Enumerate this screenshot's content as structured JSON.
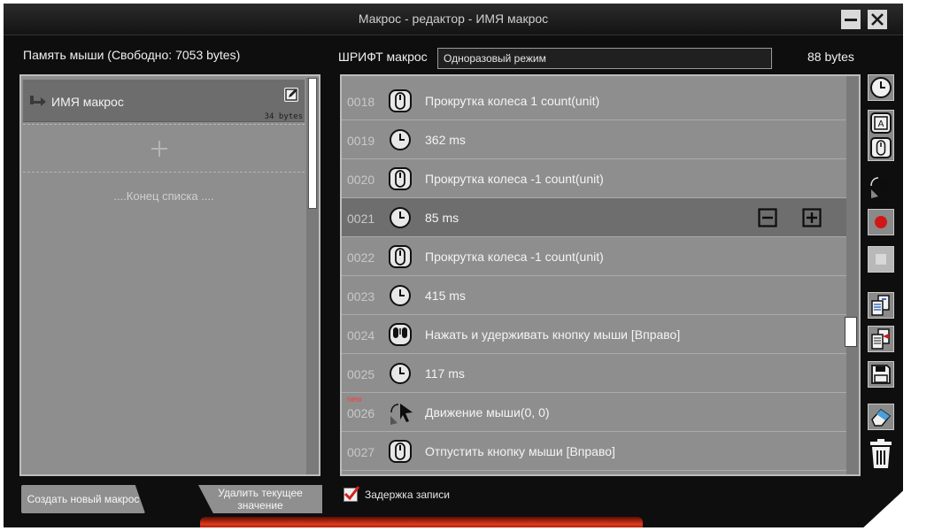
{
  "window": {
    "title": "Макрос - редактор - ИМЯ макрос"
  },
  "header": {
    "memory_label": "Память мыши (Свободно: 7053 bytes)",
    "font_label": "ШРИФТ макрос",
    "mode_value": "Одноразовый режим",
    "bytes_total": "88 bytes"
  },
  "macro_list": {
    "items": [
      {
        "name": "ИМЯ макрос",
        "bytes": "34 bytes"
      }
    ],
    "end_text": "....Конец списка ...."
  },
  "events": [
    {
      "num": "0018",
      "icon": "mouse-wheel-icon",
      "text": "Прокрутка колеса  1 count(unit)"
    },
    {
      "num": "0019",
      "icon": "clock-icon",
      "text": "362 ms"
    },
    {
      "num": "0020",
      "icon": "mouse-wheel-icon",
      "text": "Прокрутка колеса  -1 count(unit)"
    },
    {
      "num": "0021",
      "icon": "clock-icon",
      "text": "85 ms",
      "selected": true
    },
    {
      "num": "0022",
      "icon": "mouse-wheel-icon",
      "text": "Прокрутка колеса  -1 count(unit)"
    },
    {
      "num": "0023",
      "icon": "clock-icon",
      "text": "415 ms"
    },
    {
      "num": "0024",
      "icon": "mouse-right-button-icon",
      "text": "Нажать и удерживать  кнопку мыши [Вправо]"
    },
    {
      "num": "0025",
      "icon": "clock-icon",
      "text": "117 ms"
    },
    {
      "num": "0026",
      "icon": "mouse-move-icon",
      "text": "Движение мыши(0, 0)",
      "tag": "new"
    },
    {
      "num": "0027",
      "icon": "mouse-wheel-icon",
      "text": "Отпустить кнопку мыши [Вправо]"
    }
  ],
  "toolbar": {
    "icons": [
      "clock-icon",
      "keyboard-mouse-icon",
      "mouse-move-icon",
      "record-icon",
      "stop-icon",
      "copy-icon",
      "paste-icon",
      "save-icon",
      "eraser-icon",
      "trash-icon"
    ]
  },
  "footer": {
    "create_label": "Создать новый макрос",
    "delete_label": "Удалить текущее значение",
    "delay_label": "Задержка записи",
    "delay_checked": true
  },
  "colors": {
    "record": "#d01818",
    "glow": "#e23a1a",
    "new_tag": "#ff3a3a"
  }
}
